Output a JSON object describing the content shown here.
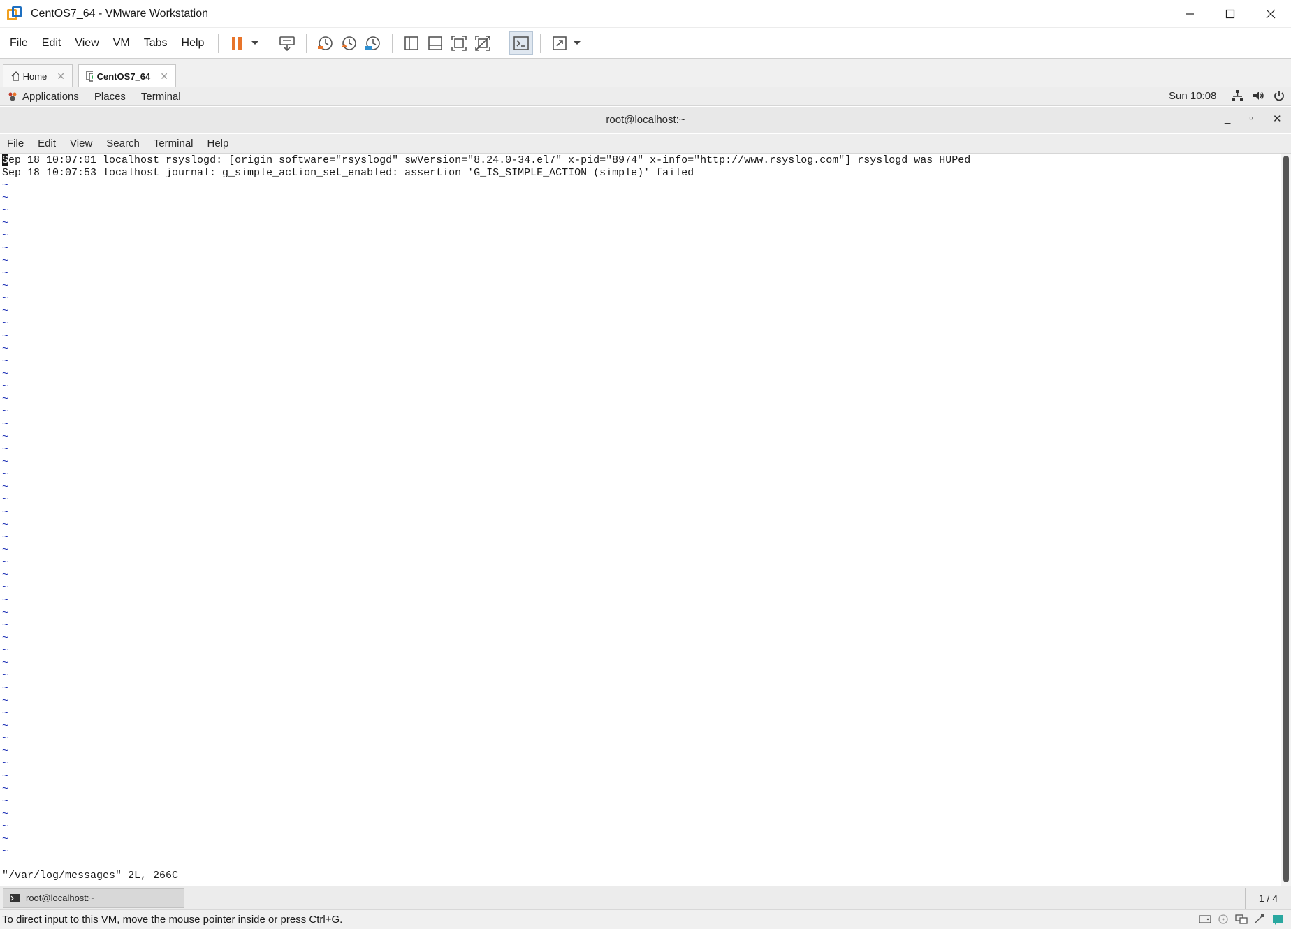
{
  "window": {
    "title": "CentOS7_64 - VMware Workstation",
    "controls": {
      "minimize": "—",
      "maximize": "☐",
      "close": "✕"
    }
  },
  "menubar": {
    "items": [
      "File",
      "Edit",
      "View",
      "VM",
      "Tabs",
      "Help"
    ]
  },
  "tabs": [
    {
      "label": "Home",
      "close": "✕"
    },
    {
      "label": "CentOS7_64",
      "close": "✕"
    }
  ],
  "gnome_panel": {
    "applications": "Applications",
    "places": "Places",
    "terminal": "Terminal",
    "clock": "Sun 10:08"
  },
  "terminal_window": {
    "title": "root@localhost:~",
    "controls": {
      "minimize": "_",
      "maximize": "▫",
      "close": "✕"
    },
    "menu": [
      "File",
      "Edit",
      "View",
      "Search",
      "Terminal",
      "Help"
    ]
  },
  "vi": {
    "cursor_char": "S",
    "line1_rest": "ep 18 10:07:01 localhost rsyslogd: [origin software=\"rsyslogd\" swVersion=\"8.24.0-34.el7\" x-pid=\"8974\" x-info=\"http://www.rsyslog.com\"] rsyslogd was HUPed",
    "line2": "Sep 18 10:07:53 localhost journal: g_simple_action_set_enabled: assertion 'G_IS_SIMPLE_ACTION (simple)' failed",
    "tilde": "~",
    "status": "\"/var/log/messages\" 2L, 266C"
  },
  "taskbar": {
    "task_label": "root@localhost:~",
    "workspace": "1 / 4"
  },
  "statusbar": {
    "message": "To direct input to this VM, move the mouse pointer inside or press Ctrl+G."
  },
  "colors": {
    "tilde": "#1c2fb5",
    "pause_orange": "#e8742a",
    "snapshot_orange": "#e8742a",
    "snapshot_blue": "#2e8fd0"
  }
}
